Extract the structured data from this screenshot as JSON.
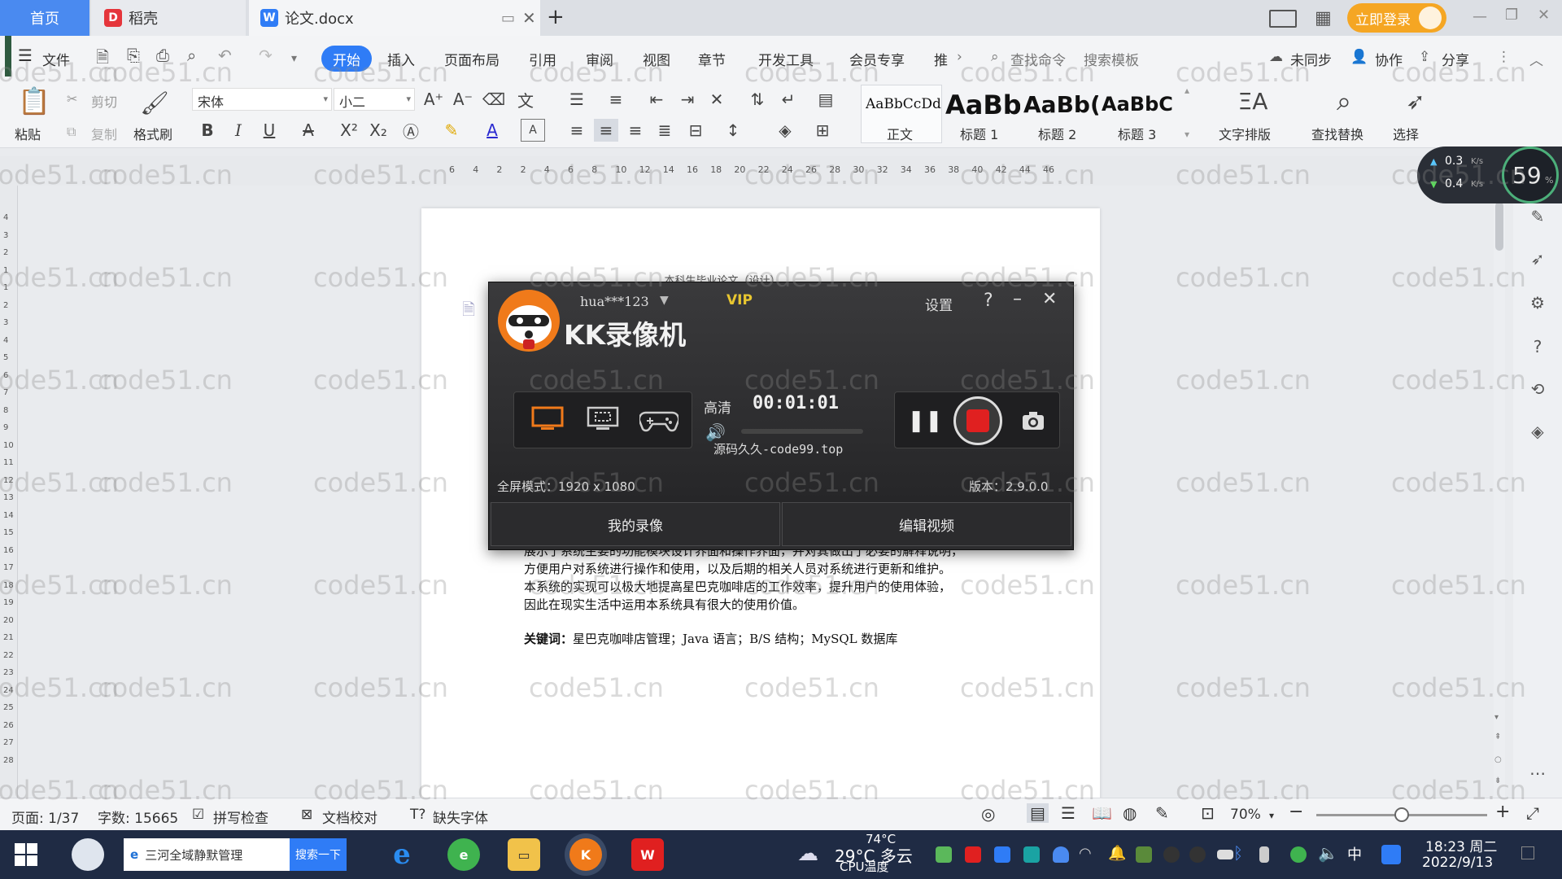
{
  "tabs": {
    "home": "首页",
    "daoke": "稻壳",
    "doc": "论文.docx",
    "new_tab": "+"
  },
  "titlebar": {
    "login": "立即登录"
  },
  "menubar": {
    "file": "文件",
    "items": [
      "开始",
      "插入",
      "页面布局",
      "引用",
      "审阅",
      "视图",
      "章节",
      "开发工具",
      "会员专享",
      "推"
    ],
    "search_cmd": "查找命令",
    "search_tpl": "搜索模板",
    "sync": "未同步",
    "collab": "协作",
    "share": "分享"
  },
  "ribbon": {
    "paste": "粘贴",
    "cut": "剪切",
    "copy": "复制",
    "format_painter": "格式刷",
    "font_name": "宋体",
    "font_size": "小二",
    "style_normal_preview": "AaBbCcDd",
    "style_normal": "正文",
    "style_h1_preview": "AaBb",
    "style_h1": "标题 1",
    "style_h2_preview": "AaBb(",
    "style_h2": "标题 2",
    "style_h3_preview": "AaBbC",
    "style_h3": "标题 3",
    "text_layout": "文字排版",
    "find_replace": "查找替换",
    "select": "选择"
  },
  "ruler": {
    "numbers": [
      "6",
      "4",
      "2",
      "2",
      "4",
      "6",
      "8",
      "10",
      "12",
      "14",
      "16",
      "18",
      "20",
      "22",
      "24",
      "26",
      "28",
      "30",
      "32",
      "34",
      "36",
      "38",
      "40",
      "42",
      "44",
      "46"
    ],
    "vnumbers": [
      "4",
      "3",
      "2",
      "1",
      "1",
      "2",
      "3",
      "4",
      "5",
      "6",
      "7",
      "8",
      "9",
      "10",
      "11",
      "12",
      "13",
      "14",
      "15",
      "16",
      "17",
      "18",
      "19",
      "20",
      "21",
      "22",
      "23",
      "24",
      "25",
      "26",
      "27",
      "28"
    ]
  },
  "speed_widget": {
    "up": "0.3",
    "down": "0.4",
    "unit": "K/s",
    "percent": "59",
    "percent_sign": "%"
  },
  "document": {
    "header": "本科生毕业论文（设计）",
    "line1": "展示了系统主要的功能模块设计界面和操作界面，并对其做出了必要的解释说明，",
    "line2": "方便用户对系统进行操作和使用，以及后期的相关人员对系统进行更新和维护。",
    "line3": "本系统的实现可以极大地提高星巴克咖啡店的工作效率，提升用户的使用体验，",
    "line4": "因此在现实生活中运用本系统具有很大的使用价值。",
    "keywords_label": "关键词：",
    "keywords": "星巴克咖啡店管理；Java 语言；B/S 结构；MySQL 数据库"
  },
  "recorder": {
    "username": "hua***123",
    "vip": "VIP",
    "settings": "设置",
    "help": "?",
    "app_name": "KK录像机",
    "quality": "高清",
    "timer": "00:01:01",
    "overlay_text": "源码久久-code99.top",
    "mode_label": "全屏模式：1920 x 1080",
    "version_label": "版本：2.9.0.0",
    "my_recordings": "我的录像",
    "edit_video": "编辑视频"
  },
  "statusbar": {
    "page": "页面: 1/37",
    "words": "字数: 15665",
    "spellcheck": "拼写检查",
    "proofread": "文档校对",
    "missing_fonts": "缺失字体",
    "zoom": "70%",
    "zoom_level": 0.5
  },
  "taskbar": {
    "search_text": "三河全域静默管理",
    "search_button": "搜索一下",
    "weather": "29°C 多云",
    "cpu": "74°C",
    "cpu_label": "CPU温度",
    "ime": "中",
    "time": "18:23 周二",
    "date": "2022/9/13"
  },
  "watermark": "code51.cn",
  "colors": {
    "accent": "#2f7cf6",
    "login_orange": "#f5a623",
    "record_red": "#e02020",
    "taskbar": "#1f2b44"
  }
}
